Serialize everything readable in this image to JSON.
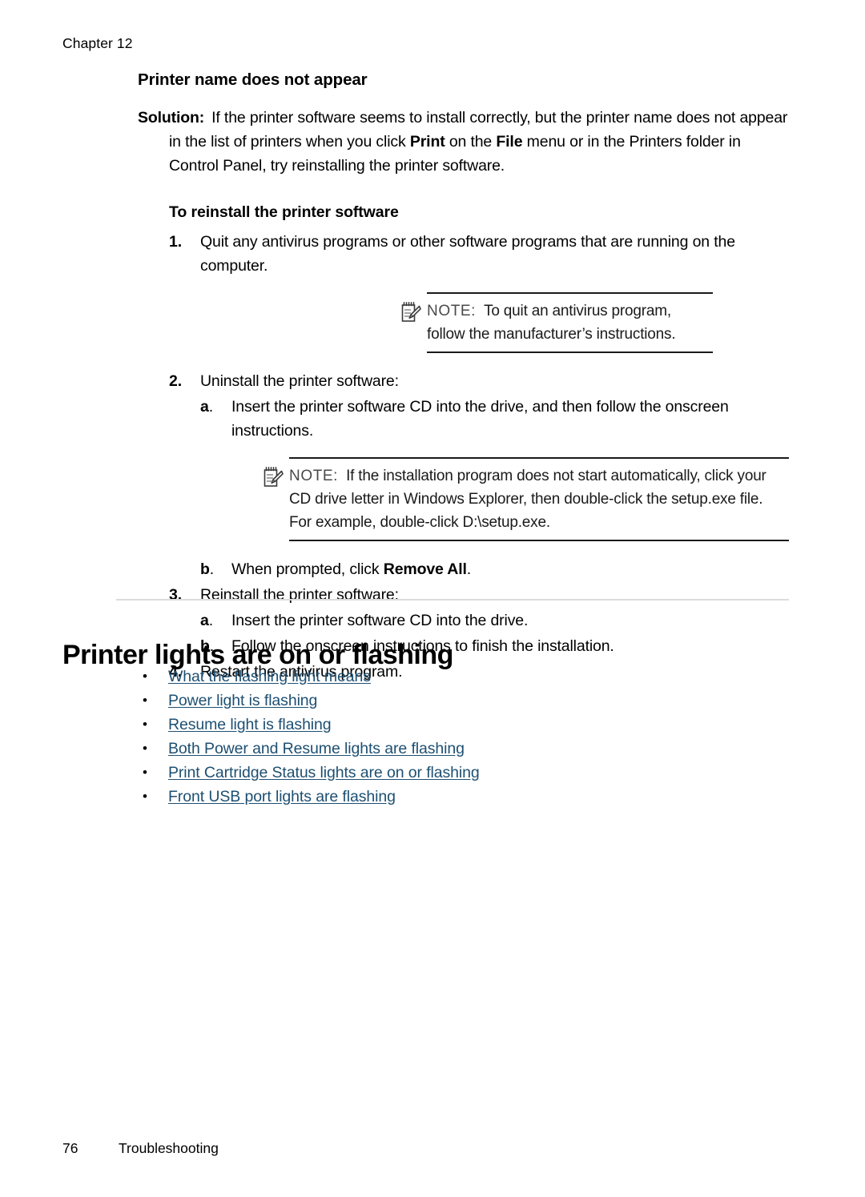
{
  "header": {
    "chapter_label": "Chapter 12"
  },
  "section_a": {
    "heading": "Printer name does not appear",
    "solution_label": "Solution:",
    "solution_parts": [
      {
        "text": "If the printer software seems to install correctly, but the printer name does not appear in the list of printers when you click ",
        "bold": false
      },
      {
        "text": "Print",
        "bold": true
      },
      {
        "text": " on the ",
        "bold": false
      },
      {
        "text": "File",
        "bold": true
      },
      {
        "text": " menu or in the Printers folder in Control Panel, try reinstalling the printer software.",
        "bold": false
      }
    ],
    "procedure_heading": "To reinstall the printer software",
    "steps": [
      {
        "marker": "1.",
        "text": "Quit any antivirus programs or other software programs that are running on the computer.",
        "note": {
          "icon": "note-pad-pencil-icon",
          "label": "NOTE:",
          "text": "To quit an antivirus program, follow the manufacturer’s instructions."
        }
      },
      {
        "marker": "2.",
        "text": "Uninstall the printer software:",
        "substeps": [
          {
            "marker": "a",
            "marker_suffix": ".",
            "text": "Insert the printer software CD into the drive, and then follow the onscreen instructions.",
            "note": {
              "icon": "note-pad-pencil-icon",
              "label": "NOTE:",
              "text": "If the installation program does not start automatically, click your CD drive letter in Windows Explorer, then double-click the setup.exe file. For example, double-click D:\\setup.exe."
            }
          },
          {
            "marker": "b",
            "marker_suffix": ".",
            "parts": [
              {
                "text": "When prompted, click ",
                "bold": false
              },
              {
                "text": "Remove All",
                "bold": true
              },
              {
                "text": ".",
                "bold": false
              }
            ]
          }
        ]
      },
      {
        "marker": "3.",
        "text": "Reinstall the printer software:",
        "substeps": [
          {
            "marker": "a",
            "marker_suffix": ".",
            "text": "Insert the printer software CD into the drive."
          },
          {
            "marker": "b",
            "marker_suffix": ".",
            "text": "Follow the onscreen instructions to finish the installation."
          }
        ]
      },
      {
        "marker": "4.",
        "text": "Restart the antivirus program."
      }
    ]
  },
  "section_b": {
    "heading": "Printer lights are on or flashing",
    "bullet_glyph": "•",
    "links": [
      {
        "label": "What the flashing light means"
      },
      {
        "label": "Power light is flashing"
      },
      {
        "label": "Resume light is flashing"
      },
      {
        "label": "Both Power and Resume lights are flashing"
      },
      {
        "label": "Print Cartridge Status lights are on or flashing"
      },
      {
        "label": "Front USB port lights are flashing"
      }
    ]
  },
  "footer": {
    "page_number": "76",
    "section_name": "Troubleshooting"
  },
  "colors": {
    "link": "#1d4f72",
    "text": "#000000",
    "note_rule": "#1a1a1a",
    "divider": "#dcdcdc"
  }
}
